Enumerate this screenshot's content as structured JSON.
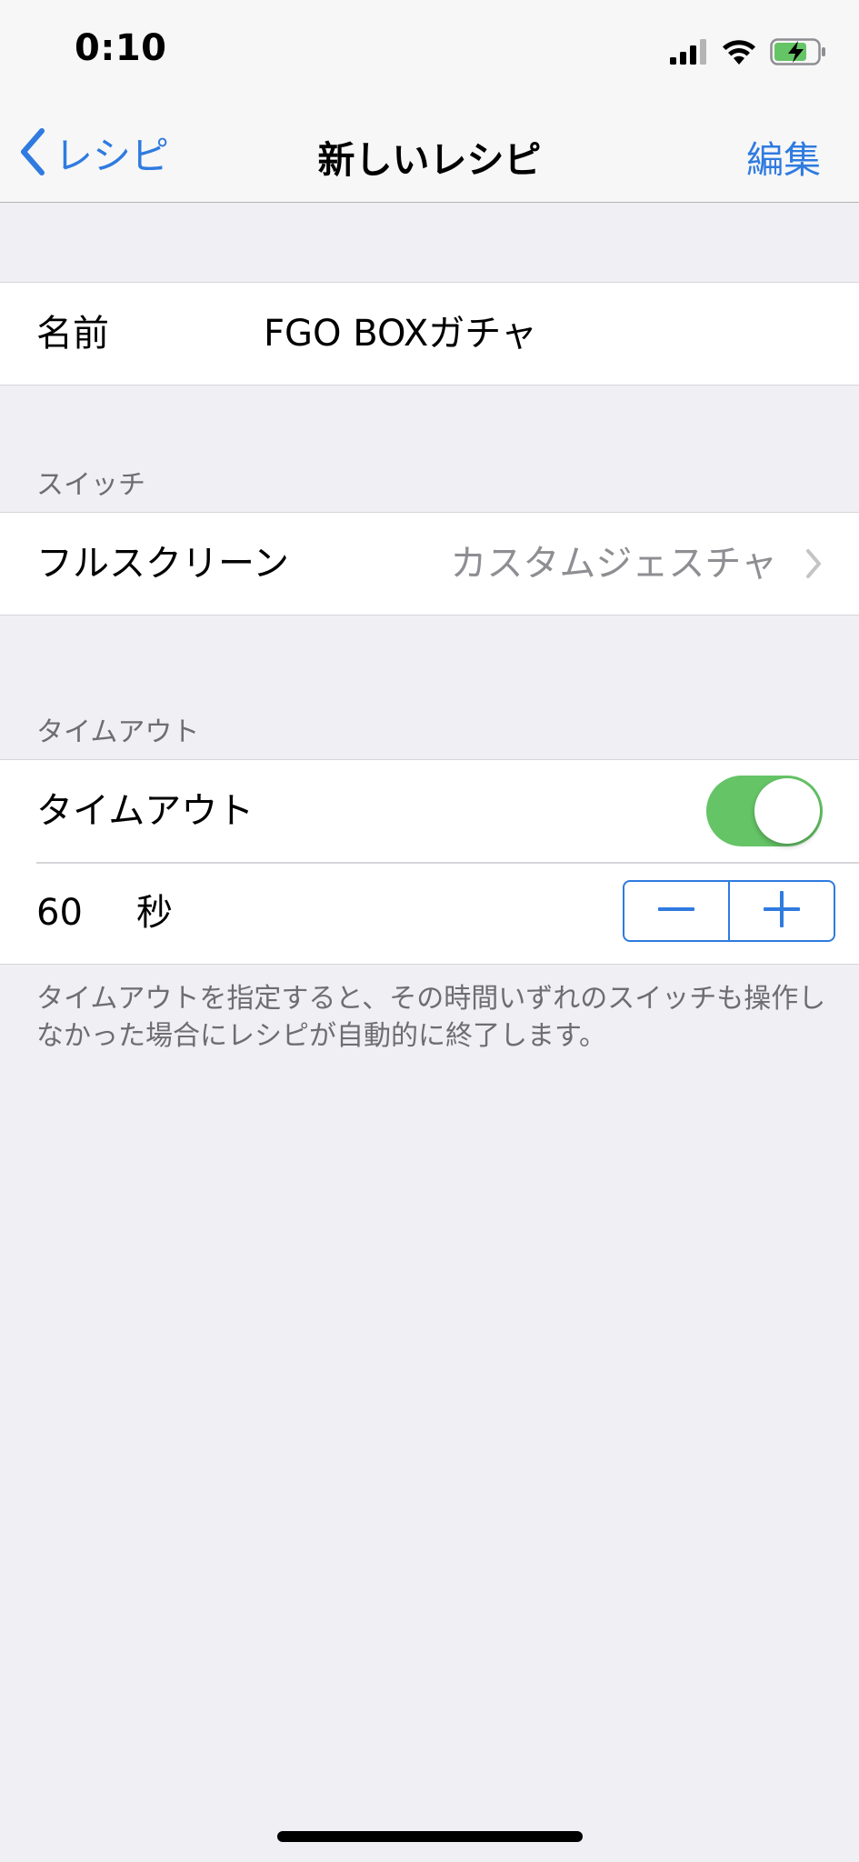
{
  "status_bar": {
    "time": "0:10"
  },
  "nav": {
    "back_label": "レシピ",
    "title": "新しいレシピ",
    "edit_label": "編集"
  },
  "name_row": {
    "label": "名前",
    "value": "FGO BOXガチャ"
  },
  "switch_section": {
    "header": "スイッチ",
    "row_label": "フルスクリーン",
    "row_value": "カスタムジェスチャ"
  },
  "timeout_section": {
    "header": "タイムアウト",
    "toggle_label": "タイムアウト",
    "toggle_on": true,
    "value": "60",
    "unit": "秒",
    "footer": "タイムアウトを指定すると、その時間いずれのスイッチも操作しなかった場合にレシピが自動的に終了します。"
  },
  "colors": {
    "accent": "#2f7be0",
    "toggle_on": "#65c466",
    "background": "#efeff4",
    "secondary_text": "#8e8e93"
  },
  "icons": {
    "back": "chevron-left-icon",
    "disclosure": "chevron-right-icon",
    "signal": "cellular-signal-icon",
    "wifi": "wifi-icon",
    "battery": "battery-charging-icon"
  }
}
